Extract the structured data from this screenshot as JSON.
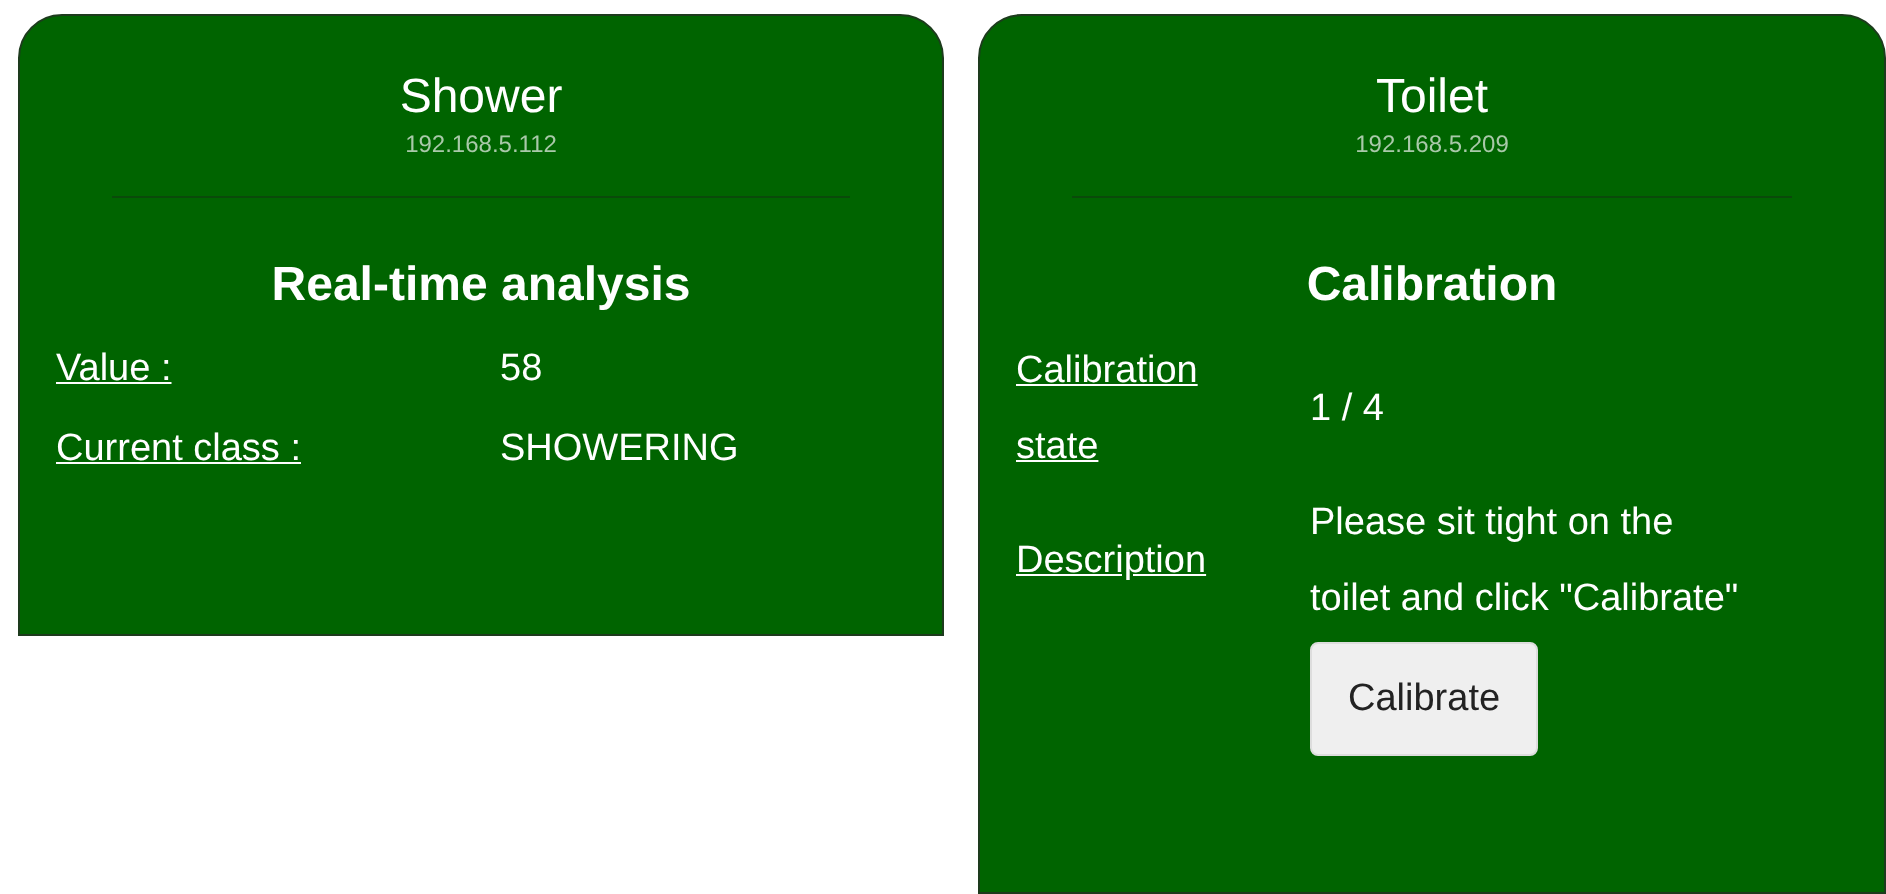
{
  "cards": [
    {
      "kind": "readings",
      "title": "Shower",
      "ip": "192.168.5.112",
      "section": "Real-time analysis",
      "rows": [
        {
          "label": "Value :",
          "value": "58"
        },
        {
          "label": "Current class :",
          "value": "SHOWERING"
        }
      ]
    },
    {
      "kind": "calibration",
      "title": "Toilet",
      "ip": "192.168.5.209",
      "section": "Calibration",
      "rows": [
        {
          "label": "Calibration state",
          "value": "1 / 4"
        },
        {
          "label": "Description",
          "value": "Please sit tight on the toilet and click \"Calibrate\""
        }
      ],
      "button": "Calibrate"
    }
  ]
}
